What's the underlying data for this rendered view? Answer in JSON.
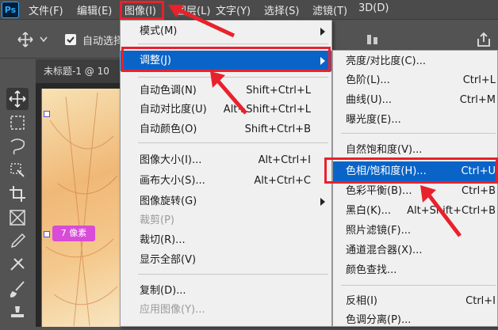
{
  "app": {
    "logo": "Ps"
  },
  "menubar": {
    "items": [
      "文件(F)",
      "编辑(E)",
      "图像(I)",
      "图层(L)",
      "文字(Y)",
      "选择(S)",
      "滤镜(T)",
      "3D(D)"
    ]
  },
  "options": {
    "auto_select_label": "自动选择"
  },
  "document": {
    "tab_title": "未标题-1 @ 10"
  },
  "canvas": {
    "pill_label": "7 像素"
  },
  "image_menu": {
    "items": [
      {
        "label": "模式(M)",
        "shortcut": "",
        "submenu": true,
        "disabled": false
      },
      {
        "label": "调整(J)",
        "shortcut": "",
        "submenu": true,
        "disabled": false,
        "highlighted": true
      },
      {
        "label": "自动色调(N)",
        "shortcut": "Shift+Ctrl+L",
        "submenu": false,
        "disabled": false
      },
      {
        "label": "自动对比度(U)",
        "shortcut": "Alt+Shift+Ctrl+L",
        "submenu": false,
        "disabled": false
      },
      {
        "label": "自动颜色(O)",
        "shortcut": "Shift+Ctrl+B",
        "submenu": false,
        "disabled": false
      },
      {
        "label": "图像大小(I)...",
        "shortcut": "Alt+Ctrl+I",
        "submenu": false,
        "disabled": false
      },
      {
        "label": "画布大小(S)...",
        "shortcut": "Alt+Ctrl+C",
        "submenu": false,
        "disabled": false
      },
      {
        "label": "图像旋转(G)",
        "shortcut": "",
        "submenu": true,
        "disabled": false
      },
      {
        "label": "裁剪(P)",
        "shortcut": "",
        "submenu": false,
        "disabled": true
      },
      {
        "label": "裁切(R)...",
        "shortcut": "",
        "submenu": false,
        "disabled": false
      },
      {
        "label": "显示全部(V)",
        "shortcut": "",
        "submenu": false,
        "disabled": false
      },
      {
        "label": "复制(D)...",
        "shortcut": "",
        "submenu": false,
        "disabled": false
      },
      {
        "label": "应用图像(Y)...",
        "shortcut": "",
        "submenu": false,
        "disabled": true
      }
    ]
  },
  "adjust_menu": {
    "items": [
      {
        "label": "亮度/对比度(C)...",
        "shortcut": ""
      },
      {
        "label": "色阶(L)...",
        "shortcut": "Ctrl+L"
      },
      {
        "label": "曲线(U)...",
        "shortcut": "Ctrl+M"
      },
      {
        "label": "曝光度(E)...",
        "shortcut": ""
      },
      {
        "label": "自然饱和度(V)...",
        "shortcut": ""
      },
      {
        "label": "色相/饱和度(H)...",
        "shortcut": "Ctrl+U",
        "highlighted": true
      },
      {
        "label": "色彩平衡(B)...",
        "shortcut": "Ctrl+B"
      },
      {
        "label": "黑白(K)...",
        "shortcut": "Alt+Shift+Ctrl+B"
      },
      {
        "label": "照片滤镜(F)...",
        "shortcut": ""
      },
      {
        "label": "通道混合器(X)...",
        "shortcut": ""
      },
      {
        "label": "颜色查找...",
        "shortcut": ""
      },
      {
        "label": "反相(I)",
        "shortcut": "Ctrl+I"
      },
      {
        "label": "色调分离(P)...",
        "shortcut": ""
      }
    ]
  },
  "colors": {
    "highlight": "#0a64c8",
    "annotation": "#e8212c"
  }
}
